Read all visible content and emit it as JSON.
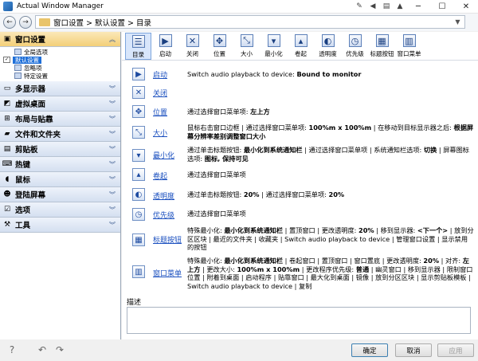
{
  "window": {
    "title": "Actual Window Manager",
    "controls": [
      "minimize-icon",
      "maximize-icon",
      "close-icon"
    ]
  },
  "address": {
    "path": "窗口设置 > 默认设置 > 目录"
  },
  "sidebar": {
    "categories": [
      {
        "label": "窗口设置",
        "icon": "window-icon",
        "open": true
      },
      {
        "label": "多显示器",
        "icon": "monitor-icon"
      },
      {
        "label": "虚拟桌面",
        "icon": "desktop-icon"
      },
      {
        "label": "布局与贴靠",
        "icon": "layout-icon"
      },
      {
        "label": "文件和文件夹",
        "icon": "folder-icon"
      },
      {
        "label": "剪贴板",
        "icon": "clipboard-icon"
      },
      {
        "label": "热键",
        "icon": "keyboard-icon"
      },
      {
        "label": "鼠标",
        "icon": "mouse-icon"
      },
      {
        "label": "登陆屏幕",
        "icon": "login-icon"
      },
      {
        "label": "选项",
        "icon": "options-icon"
      },
      {
        "label": "工具",
        "icon": "tools-icon"
      }
    ],
    "tree": [
      {
        "label": "全局选项",
        "checked": false
      },
      {
        "label": "默认设置",
        "checked": true,
        "selected": true
      },
      {
        "label": "忽略项",
        "checked": false
      },
      {
        "label": "特定设置",
        "checked": false
      }
    ]
  },
  "toolbar": {
    "items": [
      {
        "label": "目录",
        "icon": "list-icon",
        "active": true
      },
      {
        "label": "启动",
        "icon": "startup-icon"
      },
      {
        "label": "关闭",
        "icon": "close-window-icon"
      },
      {
        "label": "位置",
        "icon": "position-icon"
      },
      {
        "label": "大小",
        "icon": "size-icon"
      },
      {
        "label": "最小化",
        "icon": "minimize-window-icon"
      },
      {
        "label": "卷起",
        "icon": "rollup-icon"
      },
      {
        "label": "透明度",
        "icon": "transparency-icon"
      },
      {
        "label": "优先级",
        "icon": "priority-icon"
      },
      {
        "label": "标题按钮",
        "icon": "title-buttons-icon"
      },
      {
        "label": "窗口菜单",
        "icon": "window-menu-icon"
      }
    ]
  },
  "rows": [
    {
      "link": "启动",
      "desc": "Switch audio playback to device: <b>Bound to monitor</b>"
    },
    {
      "link": "关闭",
      "desc": ""
    },
    {
      "link": "位置",
      "desc": "通过选择窗口菜单项: <b>左上方</b>"
    },
    {
      "link": "大小",
      "desc": "鼠标右击窗口边框 | 通过选择窗口菜单项: <b>100%m x 100%m</b> | 在移动到目标显示器之后: <b>根据屏幕分辨率差别调整窗口大小</b>"
    },
    {
      "link": "最小化",
      "desc": "通过单击标题按钮: <b>最小化到系统通知栏</b> | 通过选择窗口菜单项 | 系统通知栏选项: <b>切换</b> | 屏幕图标选项: <b>图标, 保持可见</b>"
    },
    {
      "link": "卷起",
      "desc": "通过选择窗口菜单项"
    },
    {
      "link": "透明度",
      "desc": "通过单击标题按钮: <b>20%</b> | 通过选择窗口菜单项: <b>20%</b>"
    },
    {
      "link": "优先级",
      "desc": "通过选择窗口菜单项"
    },
    {
      "link": "标题按钮",
      "desc": "特殊最小化: <b>最小化到系统通知栏</b> | 置顶窗口 | 更改透明度: <b>20%</b> | 移到显示器: <b>&lt;下一个&gt;</b> | 放到分区区块 | 最近的文件夹 | 收藏夹 | Switch audio playback to device | 管理窗口设置 | 显示禁用的按钮"
    },
    {
      "link": "窗口菜单",
      "desc": "特殊最小化: <b>最小化到系统通知栏</b> | 卷起窗口 | 置顶窗口 | 窗口置底 | 更改透明度: <b>20%</b> | 对齐: <b>左上方</b> | 更改大小: <b>100%m x 100%m</b> | 更改程序优先级: <b>普通</b> | 幽灵窗口 | 移到显示器 | 限制窗口位置 | 附着到桌面 | 启动程序 | 贴靠窗口 | 最大化到桌面 | 镜像 | 放到分区区块 | 显示剪贴板模板 | Switch audio playback to device | 复制"
    }
  ],
  "description": {
    "label": "描述",
    "value": ""
  },
  "buttons": {
    "ok": "确定",
    "cancel": "取消",
    "apply": "应用"
  }
}
